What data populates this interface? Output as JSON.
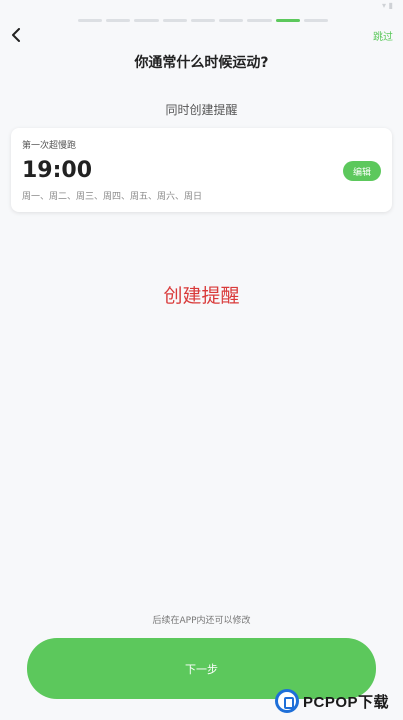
{
  "status_bar": {
    "right_indicator": "▾ ▮"
  },
  "progress": {
    "total_steps": 9,
    "current_step": 8
  },
  "header": {
    "skip_label": "跳过",
    "question": "你通常什么时候运动?"
  },
  "reminder": {
    "heading": "同时创建提醒",
    "card": {
      "title": "第一次超慢跑",
      "time": "19:00",
      "days": "周一、周二、周三、周四、周五、周六、周日",
      "edit_label": "编辑"
    }
  },
  "annotation": {
    "label": "创建提醒"
  },
  "footer": {
    "note": "后续在APP内还可以修改",
    "next_label": "下一步"
  },
  "watermark": {
    "text": "PCPOP下载"
  },
  "colors": {
    "accent": "#5cc85c",
    "annotation": "#d93a3a",
    "background": "#f7f8fa"
  }
}
